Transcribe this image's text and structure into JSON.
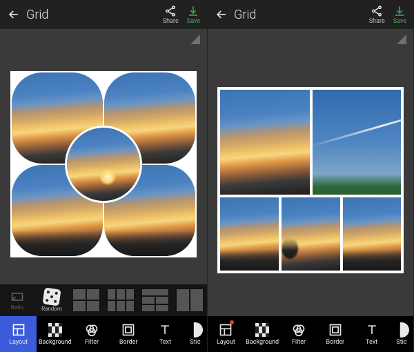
{
  "header": {
    "title": "Grid",
    "share_label": "Share",
    "save_label": "Save"
  },
  "picker": {
    "ratio_label": "Ratio",
    "random_label": "Random"
  },
  "tabs": {
    "layout": "Layout",
    "background": "Background",
    "filter": "Filter",
    "border": "Border",
    "text": "Text",
    "sticker_short": "Stic",
    "sticker": "Sticker"
  },
  "colors": {
    "accent": "#3b5bdb",
    "save": "#4caf50",
    "notify": "#e53935"
  }
}
